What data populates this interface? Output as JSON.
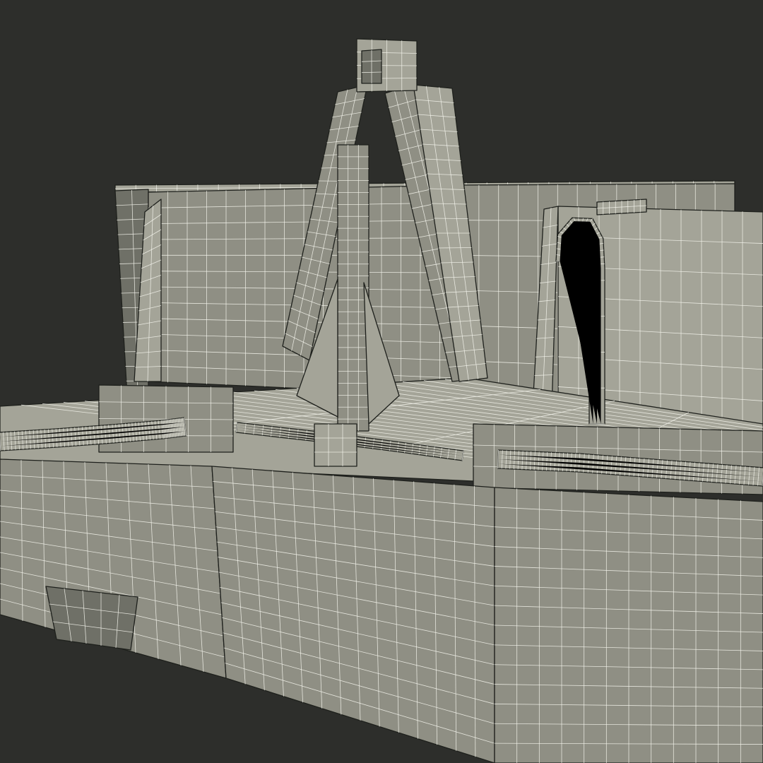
{
  "scene": {
    "colors": {
      "background": "#2d2e2b",
      "surface": "#8f8f84",
      "surface_light": "#a4a498",
      "surface_dark": "#6f7067",
      "wire": "#f4f4ec",
      "outline": "#1e201c"
    },
    "components": [
      "hull",
      "deck",
      "bulwark",
      "anchor-davit-frame",
      "anchor",
      "anchor-stock",
      "mooring-cable-left",
      "hull-fender-right",
      "vent-pipe",
      "skeg"
    ]
  }
}
